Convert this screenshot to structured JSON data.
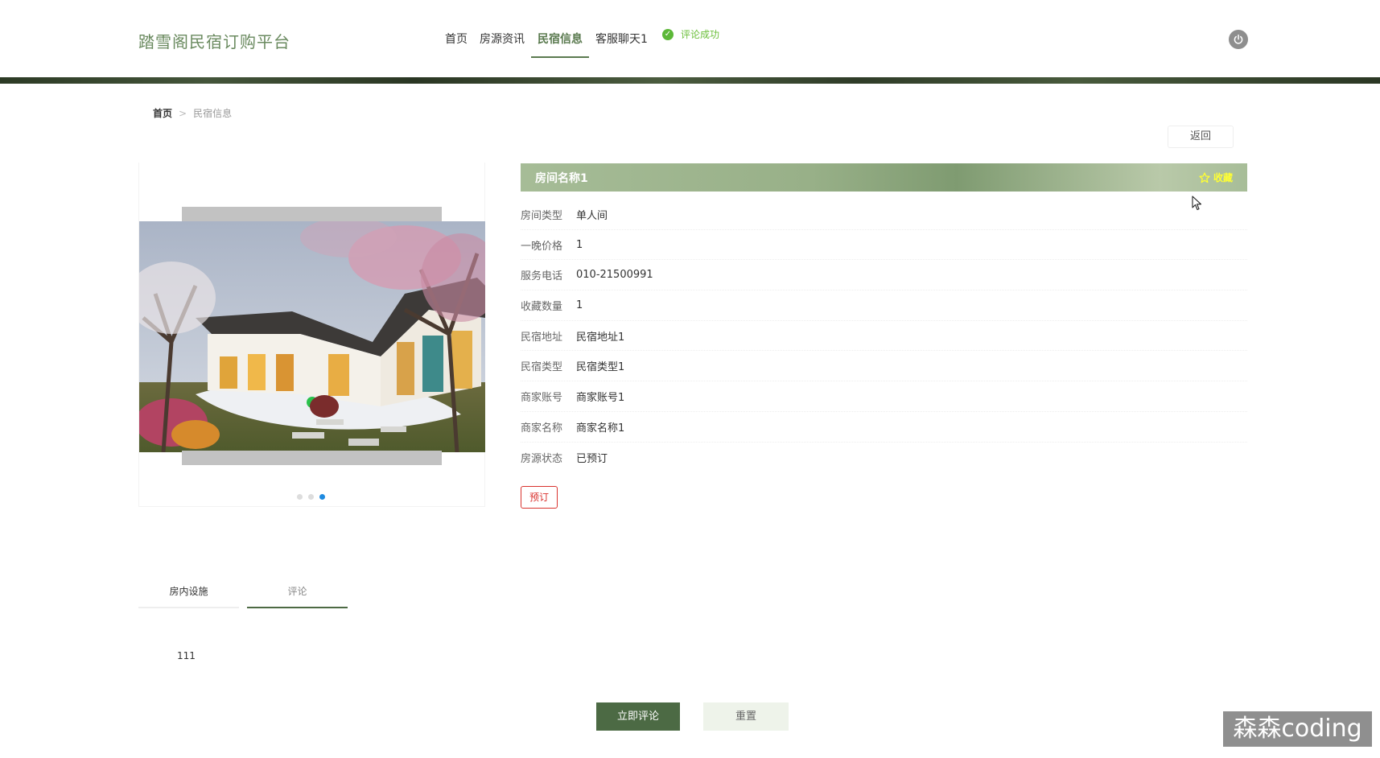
{
  "header": {
    "brand": "踏雪阁民宿订购平台",
    "nav": [
      "首页",
      "房源资讯",
      "民宿信息",
      "客服聊天1"
    ],
    "active_nav": "民宿信息",
    "toast": "评论成功"
  },
  "breadcrumb": {
    "home": "首页",
    "separator": ">",
    "current": "民宿信息"
  },
  "back_label": "返回",
  "gallery": {
    "slide_count": 3,
    "active_slide": 3,
    "active_dot_color": "#1e8ae0"
  },
  "detail": {
    "room_name": "房间名称1",
    "fav_label": "收藏",
    "fields": [
      {
        "label": "房间类型",
        "value": "单人间"
      },
      {
        "label": "一晚价格",
        "value": "1"
      },
      {
        "label": "服务电话",
        "value": "010-21500991"
      },
      {
        "label": "收藏数量",
        "value": "1"
      },
      {
        "label": "民宿地址",
        "value": "民宿地址1"
      },
      {
        "label": "民宿类型",
        "value": "民宿类型1"
      },
      {
        "label": "商家账号",
        "value": "商家账号1"
      },
      {
        "label": "商家名称",
        "value": "商家名称1"
      },
      {
        "label": "房源状态",
        "value": "已预订"
      }
    ],
    "book_label": "预订"
  },
  "tabs": {
    "items": [
      "房内设施",
      "评论"
    ],
    "active": "评论"
  },
  "comment": {
    "text": "111"
  },
  "actions": {
    "submit": "立即评论",
    "reset": "重置"
  },
  "watermark": "森森coding",
  "colors": {
    "accent": "#4c6a44",
    "brand_text": "#6a8a5f",
    "danger": "#d9322e",
    "success": "#5cb838"
  }
}
